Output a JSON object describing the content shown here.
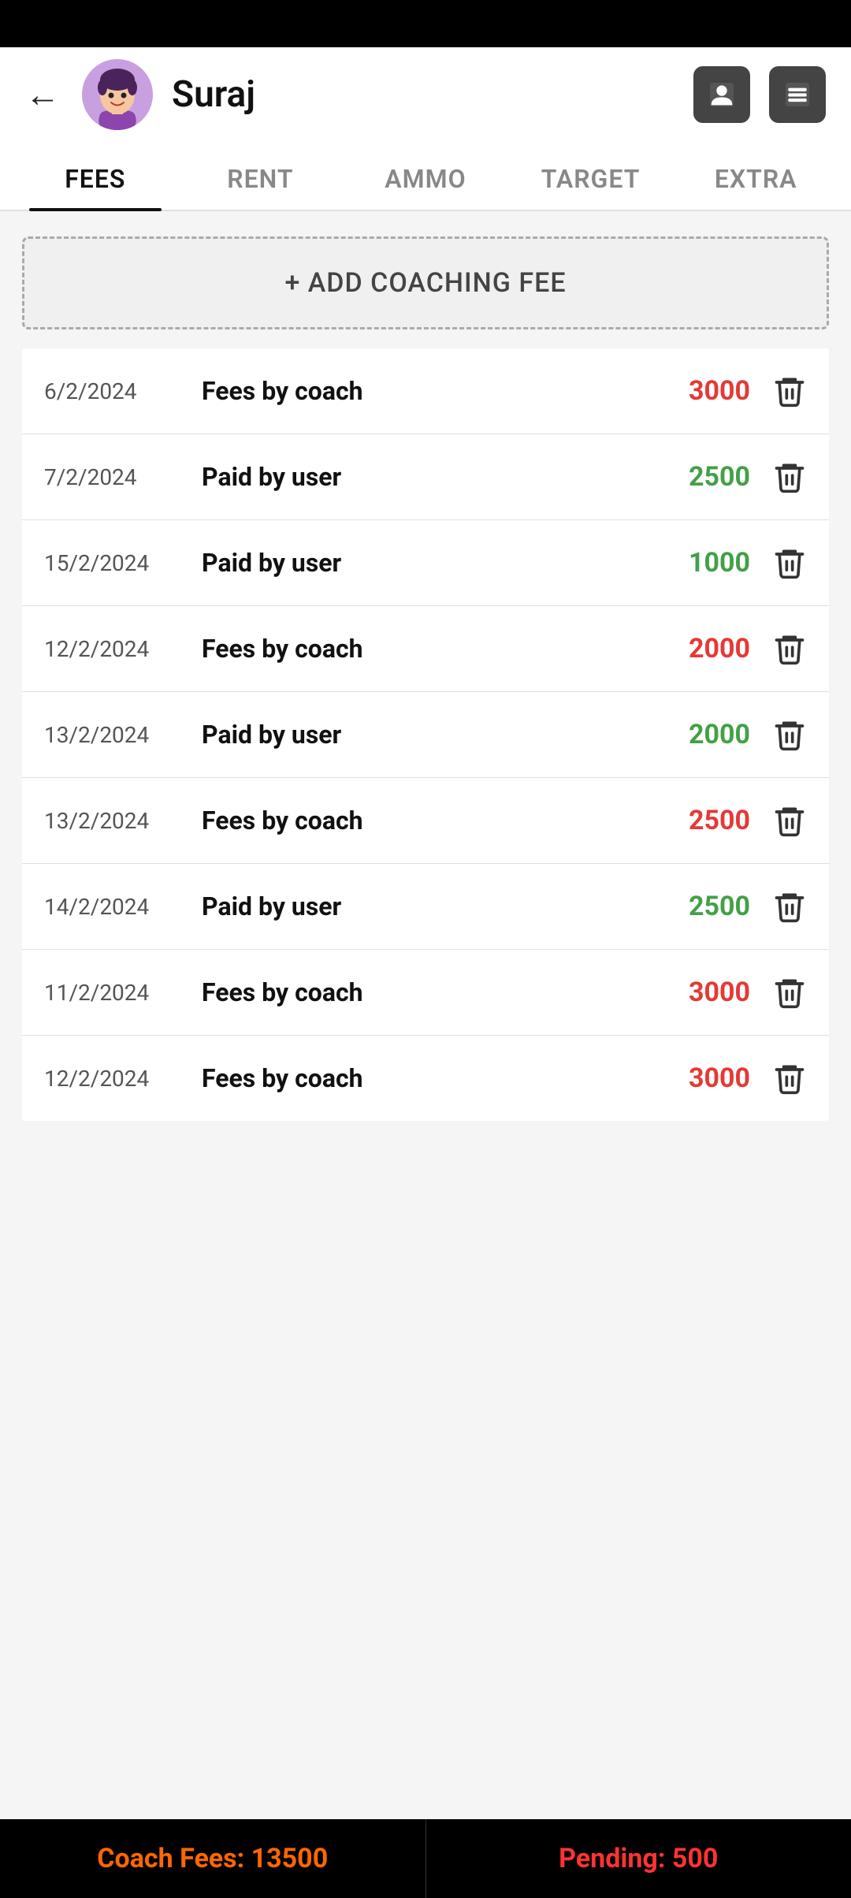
{
  "statusBar": {},
  "header": {
    "backLabel": "←",
    "userName": "Suraj",
    "profileIconAlt": "profile-icon",
    "menuIconAlt": "menu-icon"
  },
  "tabs": [
    {
      "label": "FEES",
      "active": true
    },
    {
      "label": "RENT",
      "active": false
    },
    {
      "label": "AMMO",
      "active": false
    },
    {
      "label": "TARGET",
      "active": false
    },
    {
      "label": "EXTRA",
      "active": false
    }
  ],
  "addButton": {
    "label": "+ ADD COACHING FEE"
  },
  "fees": [
    {
      "date": "6/2/2024",
      "label": "Fees by coach",
      "amount": "3000",
      "colorClass": "red"
    },
    {
      "date": "7/2/2024",
      "label": "Paid by user",
      "amount": "2500",
      "colorClass": "green"
    },
    {
      "date": "15/2/2024",
      "label": "Paid by user",
      "amount": "1000",
      "colorClass": "green"
    },
    {
      "date": "12/2/2024",
      "label": "Fees by coach",
      "amount": "2000",
      "colorClass": "red"
    },
    {
      "date": "13/2/2024",
      "label": "Paid by user",
      "amount": "2000",
      "colorClass": "green"
    },
    {
      "date": "13/2/2024",
      "label": "Fees by coach",
      "amount": "2500",
      "colorClass": "red"
    },
    {
      "date": "14/2/2024",
      "label": "Paid by user",
      "amount": "2500",
      "colorClass": "green"
    },
    {
      "date": "11/2/2024",
      "label": "Fees by coach",
      "amount": "3000",
      "colorClass": "red"
    },
    {
      "date": "12/2/2024",
      "label": "Fees by coach",
      "amount": "3000",
      "colorClass": "red"
    }
  ],
  "bottomBar": {
    "coachFeesLabel": "Coach Fees: 13500",
    "pendingLabel": "Pending: 500"
  }
}
